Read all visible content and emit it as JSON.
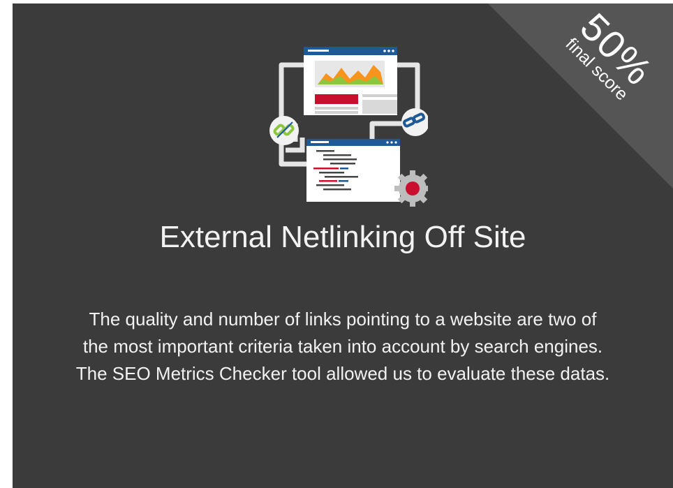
{
  "card": {
    "score_value": "50%",
    "score_label": "final score",
    "title": "External Netlinking Off Site",
    "description": "The quality and number of links pointing to a website are two of the most important criteria taken into account by search engines. The SEO Metrics Checker tool allowed us to evaluate these datas.",
    "illustration_icon": "netlinking-illustration-icon"
  },
  "colors": {
    "background": "#3b3b3b",
    "ribbon": "#555555",
    "text": "#f2f2f2",
    "accent_red": "#c8102e",
    "accent_blue": "#1f5a96",
    "accent_green": "#8cc63f",
    "accent_orange": "#f7941d"
  }
}
